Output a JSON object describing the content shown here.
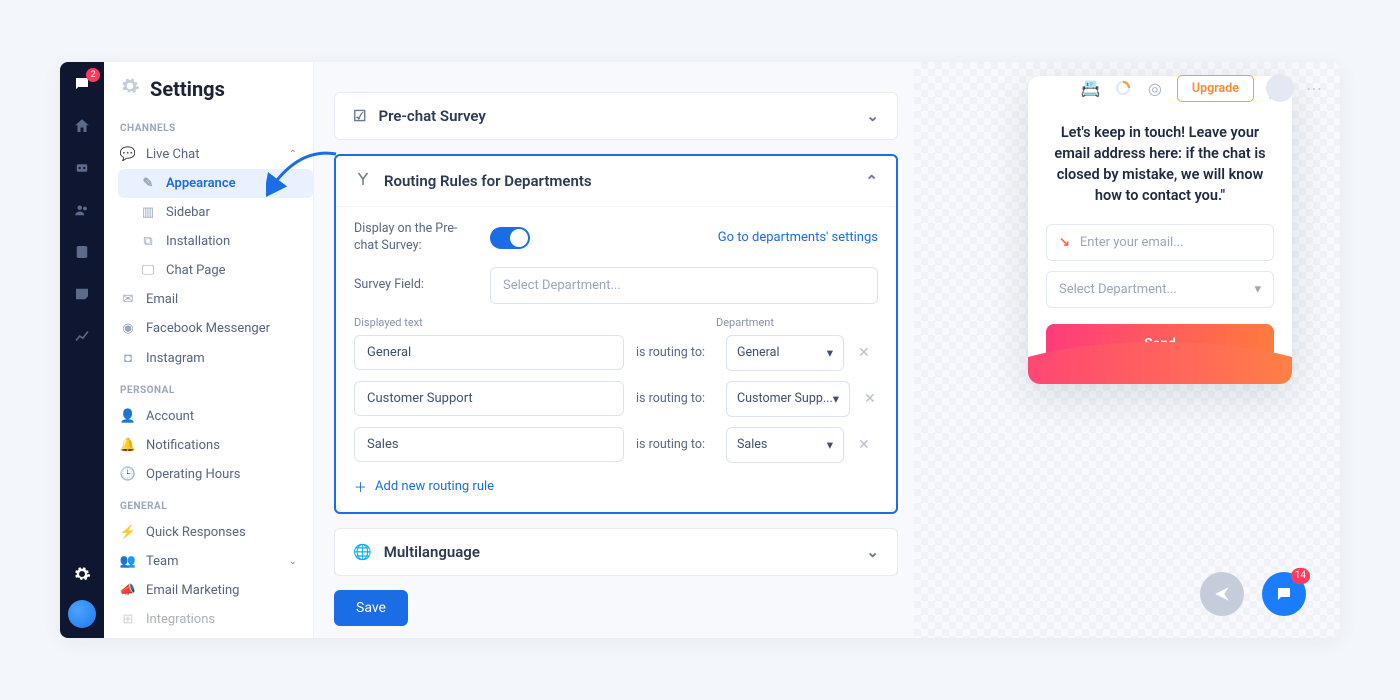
{
  "header": {
    "title": "Settings",
    "upgrade": "Upgrade"
  },
  "rail": {
    "notif_badge": "2"
  },
  "sidebar": {
    "sections": {
      "channels": "CHANNELS",
      "personal": "PERSONAL",
      "general": "GENERAL"
    },
    "items": {
      "livechat": "Live Chat",
      "appearance": "Appearance",
      "sidebar": "Sidebar",
      "installation": "Installation",
      "chatpage": "Chat Page",
      "email": "Email",
      "fbm": "Facebook Messenger",
      "instagram": "Instagram",
      "account": "Account",
      "notifications": "Notifications",
      "hours": "Operating Hours",
      "quick": "Quick Responses",
      "team": "Team",
      "emailmkt": "Email Marketing",
      "integrations": "Integrations"
    }
  },
  "panels": {
    "prechat": {
      "title": "Pre-chat Survey"
    },
    "routing": {
      "title": "Routing Rules for Departments",
      "display_label": "Display on the Pre-chat Survey:",
      "goto_link": "Go to departments' settings",
      "survey_field_label": "Survey Field:",
      "select_placeholder": "Select Department...",
      "col_displayed": "Displayed text",
      "col_department": "Department",
      "routing_text": "is routing to:",
      "rules": [
        {
          "text": "General",
          "department": "General"
        },
        {
          "text": "Customer Support",
          "department": "Customer Supp..."
        },
        {
          "text": "Sales",
          "department": "Sales"
        }
      ],
      "add_rule": "Add new routing rule"
    },
    "multilang": {
      "title": "Multilanguage"
    },
    "save": "Save"
  },
  "widget": {
    "message": "Let's keep in touch! Leave your email address here: if the chat is closed by mistake, we will know how to contact you.\"",
    "email_placeholder": "Enter your email...",
    "dept_placeholder": "Select Department...",
    "send": "Send",
    "chat_badge": "14"
  }
}
